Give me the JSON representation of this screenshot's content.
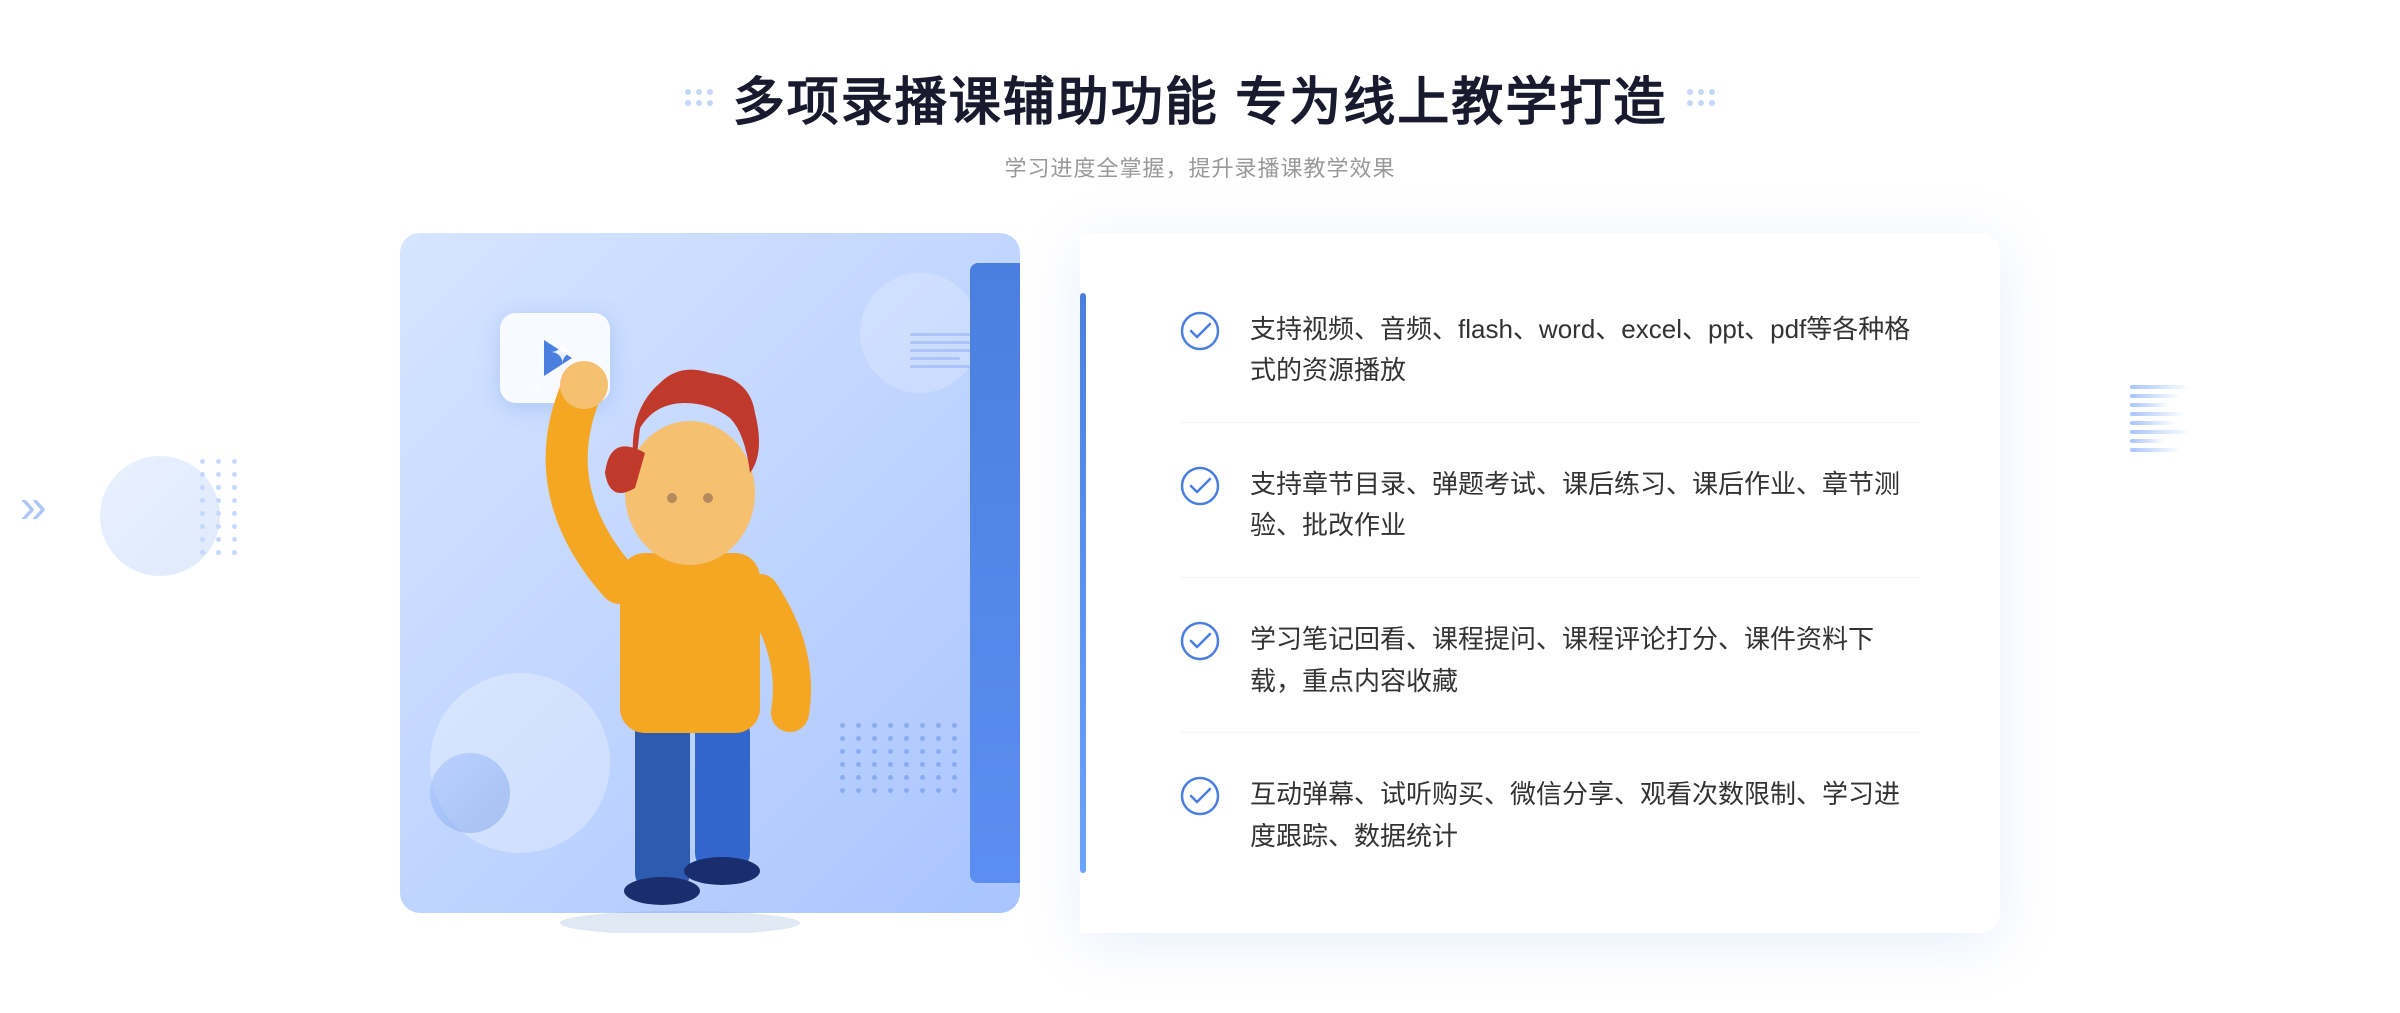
{
  "header": {
    "title": "多项录播课辅助功能 专为线上教学打造",
    "subtitle": "学习进度全掌握，提升录播课教学效果",
    "left_decoration": "grid-dots",
    "right_decoration": "grid-dots"
  },
  "features": [
    {
      "id": "feature-1",
      "text": "支持视频、音频、flash、word、excel、ppt、pdf等各种格式的资源播放"
    },
    {
      "id": "feature-2",
      "text": "支持章节目录、弹题考试、课后练习、课后作业、章节测验、批改作业"
    },
    {
      "id": "feature-3",
      "text": "学习笔记回看、课程提问、课程评论打分、课件资料下载，重点内容收藏"
    },
    {
      "id": "feature-4",
      "text": "互动弹幕、试听购买、微信分享、观看次数限制、学习进度跟踪、数据统计"
    }
  ],
  "illustration": {
    "play_button_visible": true
  },
  "colors": {
    "primary": "#4a7fdf",
    "accent": "#6ba3ff",
    "title": "#1a1a2e",
    "text": "#333333",
    "subtitle": "#999999",
    "bg_gradient_start": "#d6e4ff",
    "bg_gradient_end": "#a8c4ff",
    "check_color": "#4a7fdf"
  }
}
